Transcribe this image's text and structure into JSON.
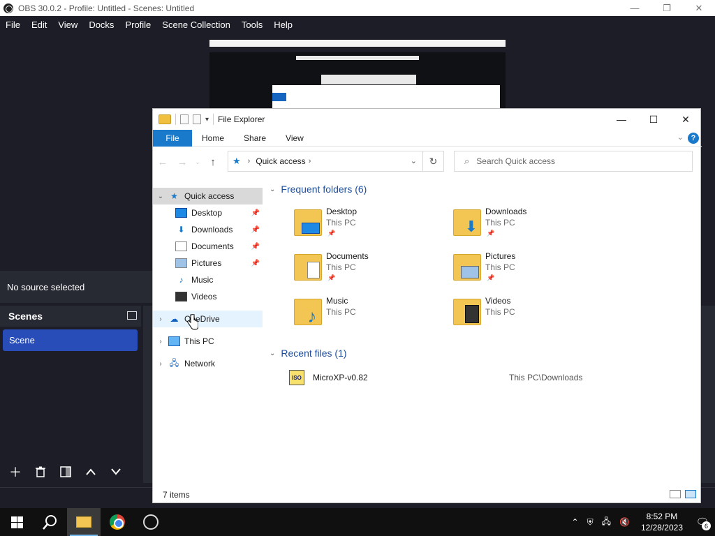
{
  "obs": {
    "window_title": "OBS 30.0.2 - Profile: Untitled - Scenes: Untitled",
    "menu": [
      "File",
      "Edit",
      "View",
      "Docks",
      "Profile",
      "Scene Collection",
      "Tools",
      "Help"
    ],
    "no_source": "No source selected",
    "scenes_title": "Scenes",
    "scenes": [
      "Scene"
    ]
  },
  "explorer": {
    "title": "File Explorer",
    "ribbon_tabs": [
      "File",
      "Home",
      "Share",
      "View"
    ],
    "address_location": "Quick access",
    "search_placeholder": "Search Quick access",
    "tree": {
      "quick_access": "Quick access",
      "items": [
        "Desktop",
        "Downloads",
        "Documents",
        "Pictures",
        "Music",
        "Videos"
      ],
      "onedrive": "OneDrive",
      "this_pc": "This PC",
      "network": "Network"
    },
    "frequent_header": "Frequent folders (6)",
    "frequent": [
      {
        "name": "Desktop",
        "location": "This PC",
        "icon": "desktop-icon",
        "pinned": true
      },
      {
        "name": "Downloads",
        "location": "This PC",
        "icon": "download-arrow-icon",
        "pinned": true
      },
      {
        "name": "Documents",
        "location": "This PC",
        "icon": "document-icon",
        "pinned": true
      },
      {
        "name": "Pictures",
        "location": "This PC",
        "icon": "picture-icon",
        "pinned": true
      },
      {
        "name": "Music",
        "location": "This PC",
        "icon": "music-note-icon",
        "pinned": false
      },
      {
        "name": "Videos",
        "location": "This PC",
        "icon": "film-icon",
        "pinned": false
      }
    ],
    "recent_header": "Recent files (1)",
    "recent": [
      {
        "name": "MicroXP-v0.82",
        "path": "This PC\\Downloads"
      }
    ],
    "status": "7 items"
  },
  "taskbar": {
    "time": "8:52 PM",
    "date": "12/28/2023",
    "notifications": "6"
  },
  "colors": {
    "obs_bg": "#1c1d26",
    "obs_panel": "#272a33",
    "scene_selected": "#284cb8",
    "explorer_accent": "#1979ca",
    "section_header": "#1e4e9c"
  }
}
